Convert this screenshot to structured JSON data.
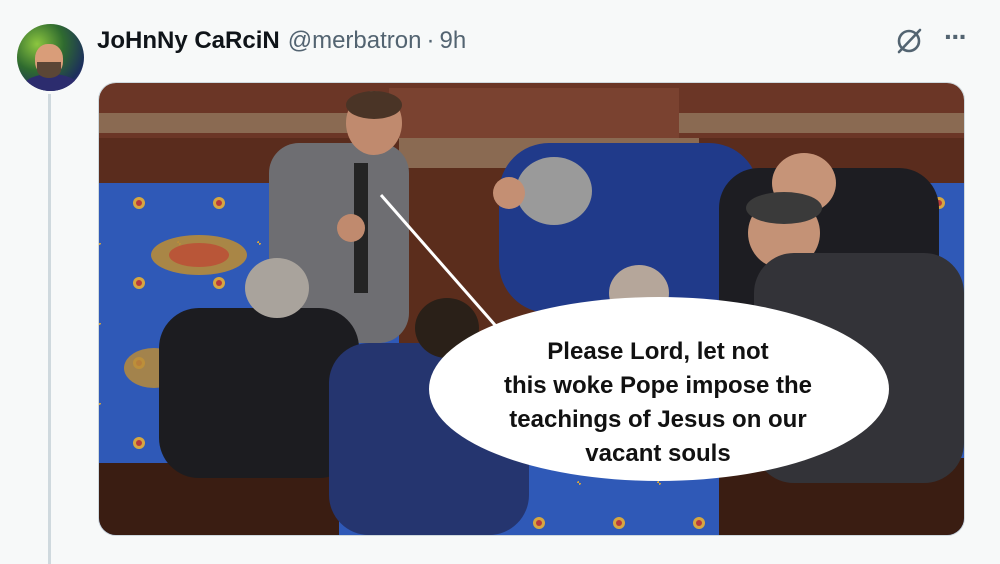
{
  "tweet": {
    "display_name": "JoHnNy CaRciN",
    "handle": "@merbatron",
    "separator": "·",
    "time": "9h",
    "more_label": "···",
    "image": {
      "speech_bubble_lines": [
        "Please Lord, let not",
        "this woke Pope impose the",
        "teachings of Jesus on our",
        "vacant souls"
      ]
    }
  },
  "icons": {
    "avatar": "user-avatar",
    "grok": "grok-icon",
    "more": "more-icon"
  }
}
